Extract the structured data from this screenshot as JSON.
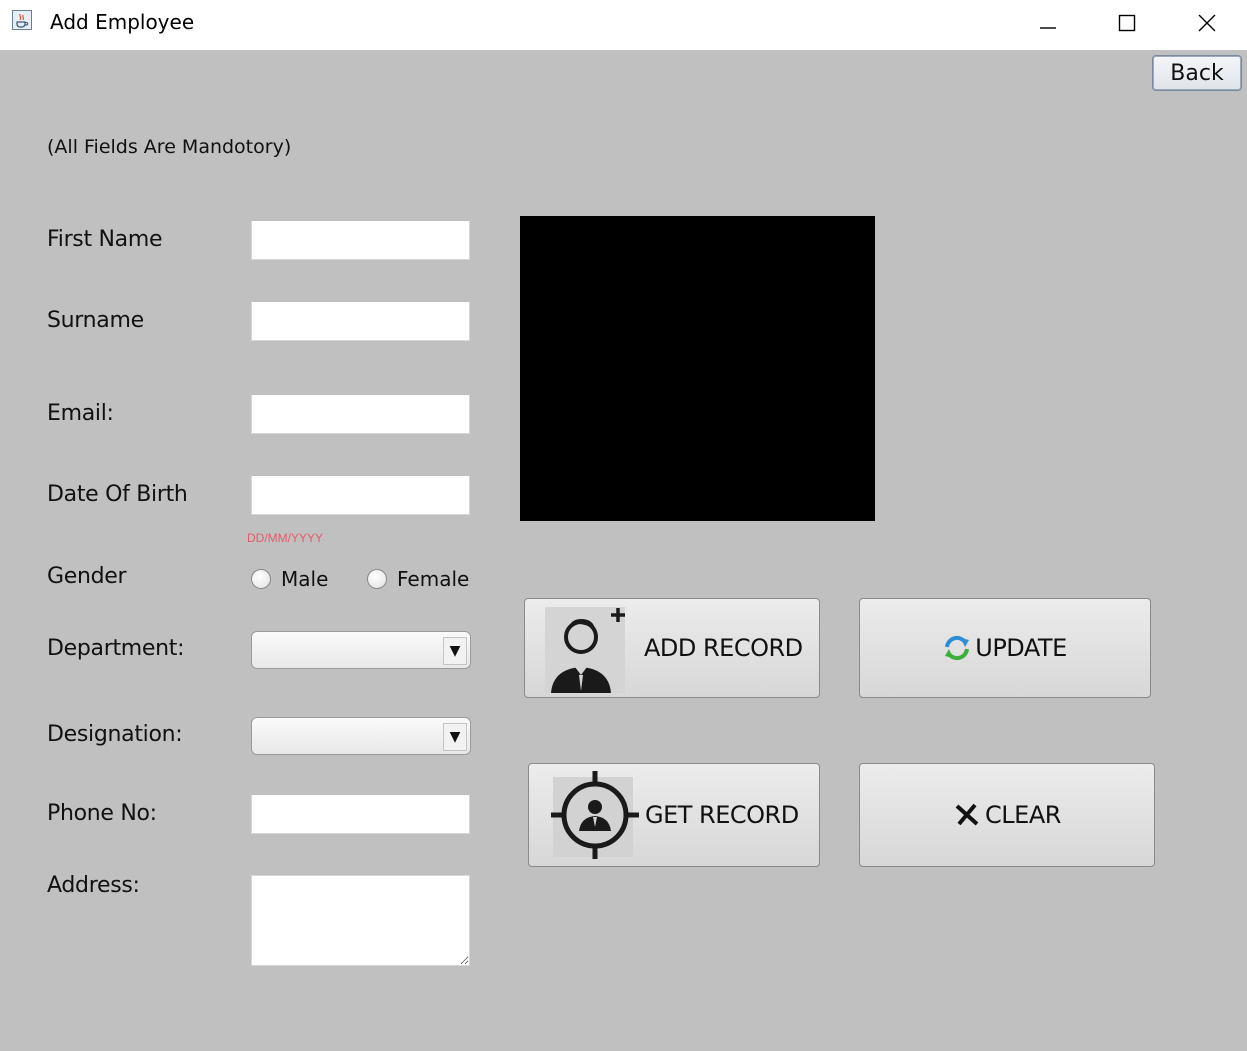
{
  "window": {
    "title": "Add Employee",
    "app_icon": "java-cup-icon"
  },
  "toolbar": {
    "back_label": "Back"
  },
  "form": {
    "note": "(All Fields Are Mandotory)",
    "labels": {
      "first_name": "First Name",
      "surname": "Surname",
      "email": "Email:",
      "dob": "Date Of Birth",
      "gender": "Gender",
      "department": "Department:",
      "designation": "Designation:",
      "phone": "Phone No:",
      "address": "Address:"
    },
    "values": {
      "first_name": "",
      "surname": "",
      "email": "",
      "dob": "",
      "department": "",
      "designation": "",
      "phone": "",
      "address": ""
    },
    "dob_hint": "DD/MM/YYYY",
    "gender_options": {
      "male": "Male",
      "female": "Female"
    }
  },
  "actions": {
    "add": "ADD RECORD",
    "update": "UPDATE",
    "get": "GET RECORD",
    "clear": "CLEAR"
  },
  "colors": {
    "background": "#c0c0c0",
    "hint": "#e35b6a",
    "photo": "#000000"
  }
}
